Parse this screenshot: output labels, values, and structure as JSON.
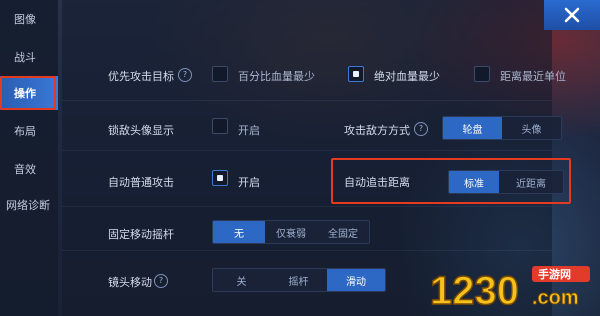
{
  "sidebar": {
    "items": [
      {
        "label": "图像"
      },
      {
        "label": "战斗"
      },
      {
        "label": "操作"
      },
      {
        "label": "布局"
      },
      {
        "label": "音效"
      },
      {
        "label": "网络诊断"
      }
    ],
    "active_index": 2
  },
  "settings": {
    "priority_target": {
      "label": "优先攻击目标",
      "options": [
        "百分比血量最少",
        "绝对血量最少",
        "距离最近单位"
      ],
      "selected": "绝对血量最少"
    },
    "lock_avatar": {
      "label": "锁敌头像显示",
      "option": "开启",
      "checked": false
    },
    "attack_enemy_mode": {
      "label": "攻击敌方方式",
      "options": [
        "轮盘",
        "头像"
      ],
      "selected": "轮盘"
    },
    "auto_normal_attack": {
      "label": "自动普通攻击",
      "option": "开启",
      "checked": true
    },
    "auto_chase_distance": {
      "label": "自动追击距离",
      "options": [
        "标准",
        "近距离"
      ],
      "selected": "标准"
    },
    "fixed_joystick": {
      "label": "固定移动摇杆",
      "options": [
        "无",
        "仅衰弱",
        "全固定"
      ],
      "selected": "无"
    },
    "camera_move": {
      "label": "镜头移动",
      "options": [
        "关",
        "摇杆",
        "滑动"
      ],
      "selected": "滑动"
    }
  },
  "close_icon": "close-x-icon",
  "watermark": {
    "number": "1230",
    "site": "手游网",
    "domain": ".com"
  },
  "colors": {
    "accent": "#2c68c4",
    "highlight": "#e43a1f",
    "background": "#1b2438"
  }
}
